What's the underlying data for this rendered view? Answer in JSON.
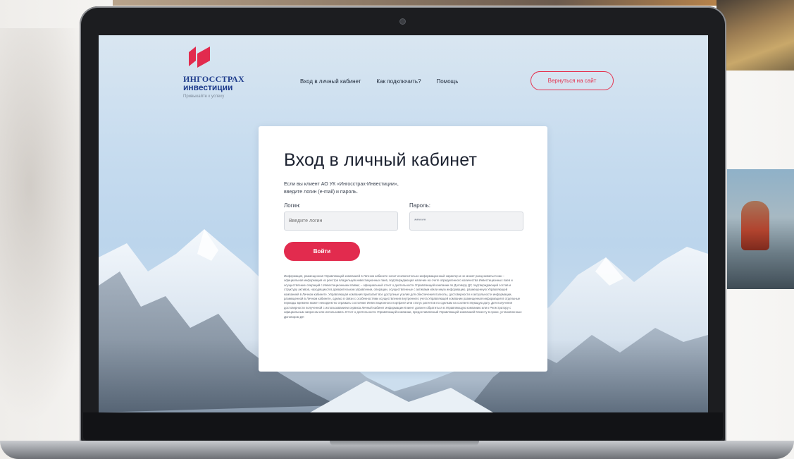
{
  "header": {
    "brand_line1": "ИНГОССТРАХ",
    "brand_line2": "инвестиции",
    "brand_tagline": "Привыкайте к успеху",
    "nav": [
      {
        "label": "Вход в личный кабинет"
      },
      {
        "label": "Как подключить?"
      },
      {
        "label": "Помощь"
      }
    ],
    "back_button": "Вернуться на сайт"
  },
  "login": {
    "title": "Вход в личный кабинет",
    "intro_line1": "Если вы клиент АО УК «Ингосстрах-Инвестиции»,",
    "intro_line2": "введите логин (e-mail) и пароль.",
    "login_label": "Логин:",
    "login_placeholder": "Введите логин",
    "password_label": "Пароль:",
    "password_value": "******",
    "submit": "Войти",
    "disclaimer": "Информация, размещенная Управляющей компанией в Личном кабинете носит исключительно информационный характер и не может расцениваться как – официальная информация из реестра владельцев инвестиционных паев, подтверждающая наличие на счете определенного количества Инвестиционных паев и осуществление операций с Инвестиционными паями; – официальный отчет о деятельности Управляющей компании по Договору ДУ, подтверждающий состав и структуру активов, находящихся в доверительном управлении, операции, осуществленные с активами и/или иную информацию, размещенную Управляющей компанией в Личном кабинете. Управляющая компания прилагает все доступные усилия для обеспечения полноты, достоверности и актуальности информации, размещенной в Личном кабинете, однако в связи с особенностями осуществления внутреннего учета Управляющей компании размещенная информация в отдельные периоды времени может некорректно отражать состояние Инвестиционного портфеля или статус расчетов по сделкам на соответствующую дату. Для получения достоверности полученной с использованием сервиса Личный кабинет информации Клиент должен обратиться в Управляющую компанию или к Регистратору с официальным запросом или использовать Отчет о деятельности Управляющей компании, предоставляемый Управляющей компанией Клиенту в сроки, установленные Договором ДУ."
  },
  "colors": {
    "accent": "#e22b4e",
    "brand_blue": "#1d3b8b"
  }
}
